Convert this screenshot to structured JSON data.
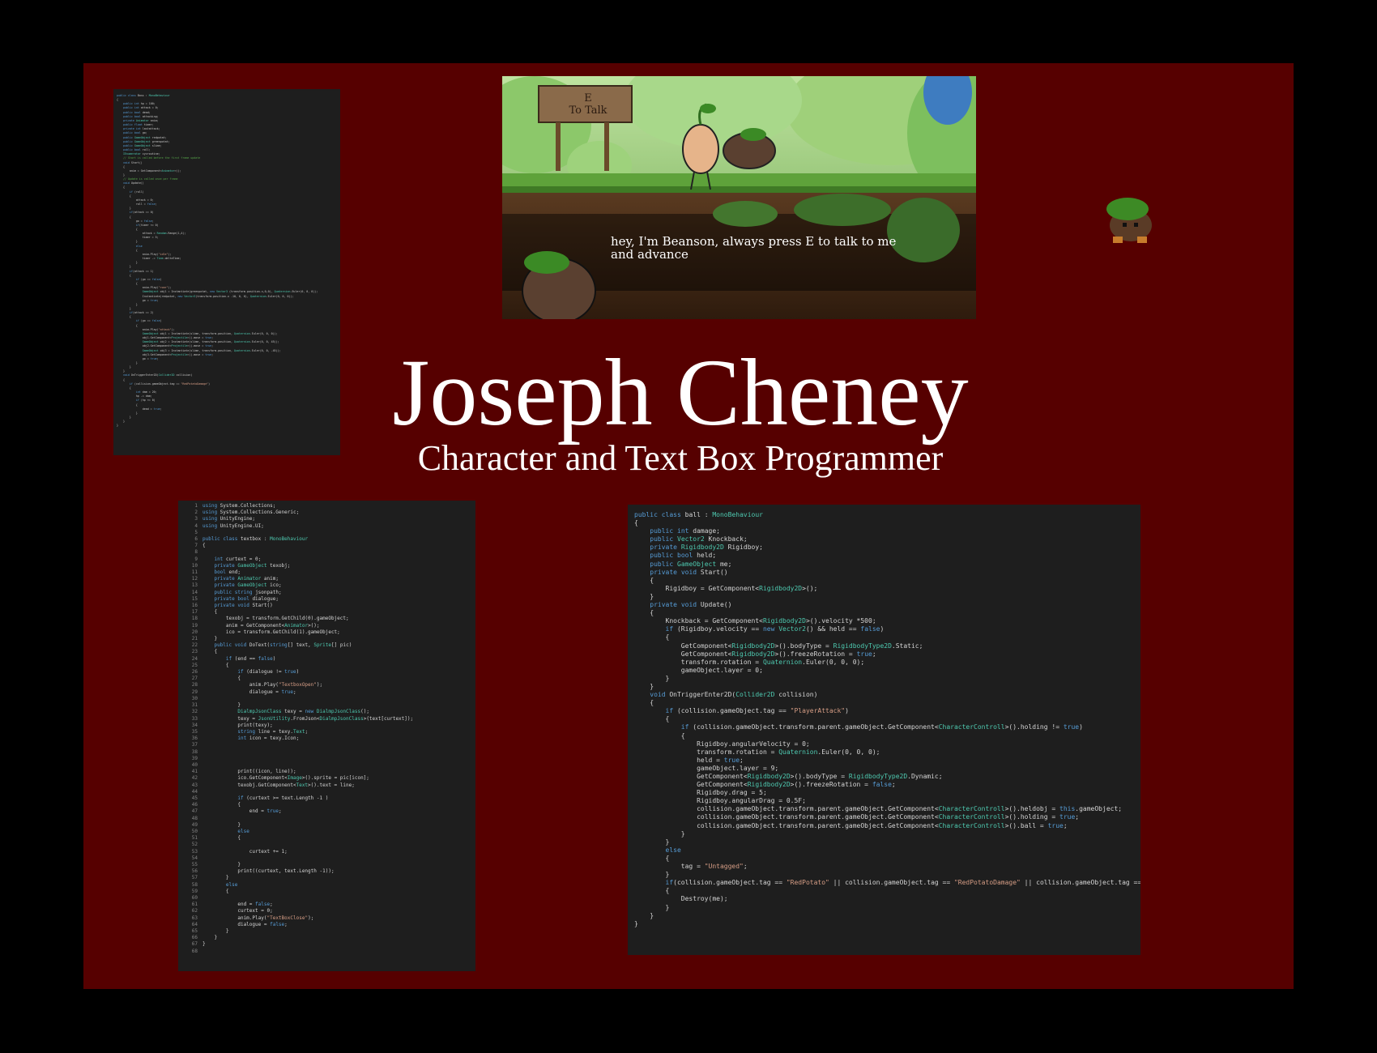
{
  "poster": {
    "name": "Joseph Cheney",
    "role": "Character and Text Box Programmer"
  },
  "game_screenshot": {
    "sign_text": "E\nTo Talk",
    "dialogue": "hey, I'm Beanson, always press E to talk to me and advance"
  },
  "textbox_code": [
    "using System.Collections;",
    "using System.Collections.Generic;",
    "using UnityEngine;",
    "using UnityEngine.UI;",
    "",
    "public class textbox : MonoBehaviour",
    "{",
    "",
    "    int curtext = 0;",
    "    private GameObject texobj;",
    "    bool end;",
    "    private Animator anim;",
    "    private GameObject ico;",
    "    public string jsonpath;",
    "    private bool dialogue;",
    "    private void Start()",
    "    {",
    "        texobj = transform.GetChild(0).gameObject;",
    "        anim = GetComponent<Animator>();",
    "        ico = transform.GetChild(1).gameObject;",
    "    }",
    "    public void DoText(string[] text, Sprite[] pic)",
    "    {",
    "        if (end == false)",
    "        {",
    "            if (dialogue != true)",
    "            {",
    "                anim.Play(\"TextboxOpen\");",
    "                dialogue = true;",
    "",
    "            }",
    "            DialmpJsonClass texy = new DialmpJsonClass();",
    "            texy = JsonUtility.FromJson<DialmpJsonClass>(text[curtext]);",
    "            print(texy);",
    "            string line = texy.Text;",
    "            int icon = texy.Icon;",
    "",
    "",
    "",
    "",
    "            print((icon, line));",
    "            ico.GetComponent<Image>().sprite = pic[icon];",
    "            texobj.GetComponent<Text>().text = line;",
    "",
    "            if (curtext >= text.Length -1 )",
    "            {",
    "                end = true;",
    "",
    "            }",
    "            else",
    "            {",
    "",
    "                curtext += 1;",
    "",
    "            }",
    "            print((curtext, text.Length -1));",
    "        }",
    "        else",
    "        {",
    "",
    "            end = false;",
    "            curtext = 0;",
    "            anim.Play(\"TextBoxClose\");",
    "            dialogue = false;",
    "        }",
    "    }",
    "}",
    ""
  ],
  "ball_code": [
    "public class ball : MonoBehaviour",
    "{",
    "    public int damage;",
    "    public Vector2 Knockback;",
    "    private Rigidbody2D Rigidboy;",
    "    public bool held;",
    "",
    "    public GameObject me;",
    "    private void Start()",
    "    {",
    "        Rigidboy = GetComponent<Rigidbody2D>();",
    "    }",
    "",
    "",
    "    private void Update()",
    "    {",
    "        Knockback = GetComponent<Rigidbody2D>().velocity *500;",
    "        if (Rigidboy.velocity == new Vector2() && held == false)",
    "        {",
    "            GetComponent<Rigidbody2D>().bodyType = RigidbodyType2D.Static;",
    "            GetComponent<Rigidbody2D>().freezeRotation = true;",
    "            transform.rotation = Quaternion.Euler(0, 0, 0);",
    "            gameObject.layer = 0;",
    "        }",
    "    }",
    "    void OnTriggerEnter2D(Collider2D collision)",
    "    {",
    "        if (collision.gameObject.tag == \"PlayerAttack\")",
    "        {",
    "            if (collision.gameObject.transform.parent.gameObject.GetComponent<CharacterControll>().holding != true)",
    "            {",
    "                Rigidboy.angularVelocity = 0;",
    "                transform.rotation = Quaternion.Euler(0, 0, 0);",
    "                held = true;",
    "                gameObject.layer = 9;",
    "                GetComponent<Rigidbody2D>().bodyType = RigidbodyType2D.Dynamic;",
    "                GetComponent<Rigidbody2D>().freezeRotation = false;",
    "                Rigidboy.drag = 5;",
    "                Rigidboy.angularDrag = 0.5F;",
    "                collision.gameObject.transform.parent.gameObject.GetComponent<CharacterControll>().heldobj = this.gameObject;",
    "                collision.gameObject.transform.parent.gameObject.GetComponent<CharacterControll>().holding = true;",
    "                collision.gameObject.transform.parent.gameObject.GetComponent<CharacterControll>().ball = true;",
    "            }",
    "        }",
    "        else",
    "        {",
    "            tag = \"Untagged\";",
    "        }",
    "        if(collision.gameObject.tag == \"RedPotato\" || collision.gameObject.tag == \"RedPotatoDamage\" || collision.gameObject.tag == \"Enemy\")",
    "        {",
    "            Destroy(me);",
    "        }",
    "    }",
    "}"
  ],
  "boss_code": [
    "public class Boss : MonoBehaviour",
    "{",
    "    public int hp = 100;",
    "    public int attack = 0;",
    "    public bool dead;",
    "    public bool attacking;",
    "    private Animator anim;",
    "    public float timer;",
    "    private int lastattack;",
    "    public bool go;",
    "    public GameObject redpotat;",
    "    public GameObject greenpotat;",
    "    public GameObject slime;",
    "    public bool roll;",
    "    IEnumerator cycroutine;",
    "    // Start is called before the first frame update",
    "    void Start()",
    "    {",
    "        anim = GetComponent<Animator>();",
    "    }",
    "",
    "    // Update is called once per frame",
    "    void Update()",
    "    {",
    "        if (roll)",
    "        {",
    "            attack = 0;",
    "            roll = false;",
    "        }",
    "        if(attack == 0)",
    "        {",
    "",
    "            go = false;",
    "            if(timer <= 0)",
    "            {",
    "                attack = Random.Range(1,4);",
    "                timer = 5;",
    "            }",
    "            else",
    "            {",
    "                anim.Play(\"idle\");",
    "                timer -= Time.deltaTime;",
    "            }",
    "        }",
    "        if(attack == 1)",
    "        {",
    "            if (go == false)",
    "            {",
    "                anim.Play(\"roar\");",
    "                GameObject obj1 = Instantiate(greenpotat, new Vector3 (transform.position.x,0,0), Quaternion.Euler(0, 0, 0));",
    "                Instantiate(redpotat, new Vector3(transform.position.x -10, 0, 0), Quaternion.Euler(0, 0, 0));",
    "",
    "                go = true;",
    "            }",
    "        }",
    "        if(attack == 2)",
    "        {",
    "            if (go == false)",
    "            {",
    "                anim.Play(\"attack\");",
    "                GameObject obj1 = Instantiate(slime, transform.position, Quaternion.Euler(0, 0, 0));",
    "                obj1.GetComponent<Projectile>().move = true;",
    "                GameObject obj2 = Instantiate(slime, transform.position, Quaternion.Euler(0, 0, 45));",
    "                obj2.GetComponent<Projectile>().move = true;",
    "                GameObject obj3 = Instantiate(slime, transform.position, Quaternion.Euler(0, 0, -45));",
    "                obj3.GetComponent<Projectile>().move = true;",
    "                go = true;",
    "            }",
    "",
    "        }",
    "",
    "    }",
    "    void OnTriggerEnter2D(Collider2D collision)",
    "    {",
    "        if (collision.gameObject.tag == \"RedPotatoDamage\")",
    "        {",
    "            int dam = 20;",
    "            hp -= dam;",
    "",
    "            if (hp <= 0)",
    "            {",
    "                dead = true;",
    "            }",
    "        }",
    "    }",
    "}"
  ],
  "colors": {
    "background": "#000000",
    "board": "#560000",
    "code_bg": "#1e1e1e",
    "keyword": "#569cd6",
    "type": "#4ec9b0",
    "string": "#d69d85"
  }
}
